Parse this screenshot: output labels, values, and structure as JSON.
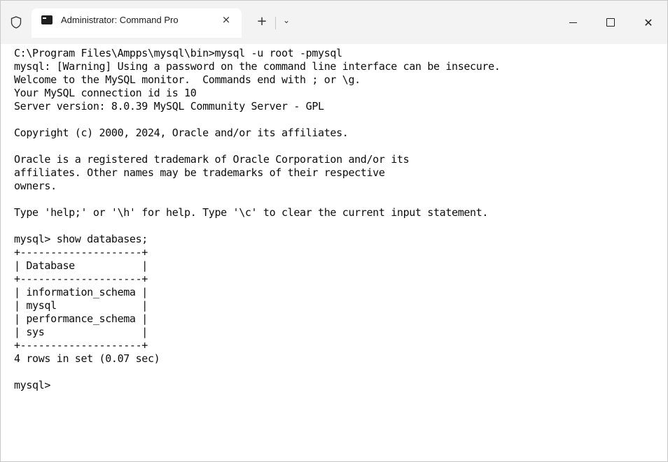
{
  "window": {
    "tab_title": "Administrator: Command Pro",
    "tab_close_label": "×",
    "new_tab_label": "+",
    "dropdown_label": "⌄",
    "minimize_label": "–",
    "maximize_label": "□",
    "close_label": "✕"
  },
  "terminal": {
    "lines": [
      "C:\\Program Files\\Ampps\\mysql\\bin>mysql -u root -pmysql",
      "mysql: [Warning] Using a password on the command line interface can be insecure.",
      "Welcome to the MySQL monitor.  Commands end with ; or \\g.",
      "Your MySQL connection id is 10",
      "Server version: 8.0.39 MySQL Community Server - GPL",
      "",
      "Copyright (c) 2000, 2024, Oracle and/or its affiliates.",
      "",
      "Oracle is a registered trademark of Oracle Corporation and/or its",
      "affiliates. Other names may be trademarks of their respective",
      "owners.",
      "",
      "Type 'help;' or '\\h' for help. Type '\\c' to clear the current input statement.",
      "",
      "mysql> show databases;",
      "+--------------------+",
      "| Database           |",
      "+--------------------+",
      "| information_schema |",
      "| mysql              |",
      "| performance_schema |",
      "| sys                |",
      "+--------------------+",
      "4 rows in set (0.07 sec)",
      "",
      "mysql> "
    ]
  },
  "colors": {
    "titlebar_bg": "#f3f3f3",
    "terminal_bg": "#ffffff",
    "terminal_fg": "#0c0c0c"
  }
}
